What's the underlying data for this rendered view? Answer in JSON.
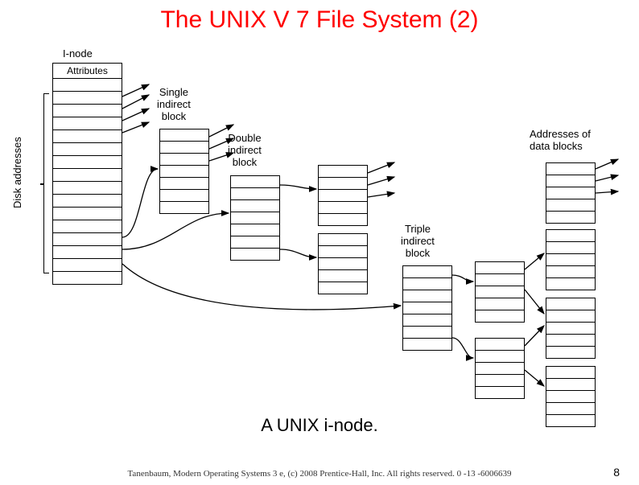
{
  "title": "The UNIX V 7 File System (2)",
  "caption": "A UNIX i-node.",
  "footer": "Tanenbaum, Modern Operating Systems 3 e, (c) 2008 Prentice-Hall, Inc. All rights reserved. 0 -13 -6006639",
  "page_number": "8",
  "labels": {
    "inode": "I-node",
    "attributes": "Attributes",
    "disk_addresses": "Disk addresses",
    "single_indirect": "Single\nindirect\nblock",
    "double_indirect": "Double\nindirect\nblock",
    "triple_indirect": "Triple\nindirect\nblock",
    "addresses_of_data_blocks": "Addresses of\ndata blocks"
  }
}
